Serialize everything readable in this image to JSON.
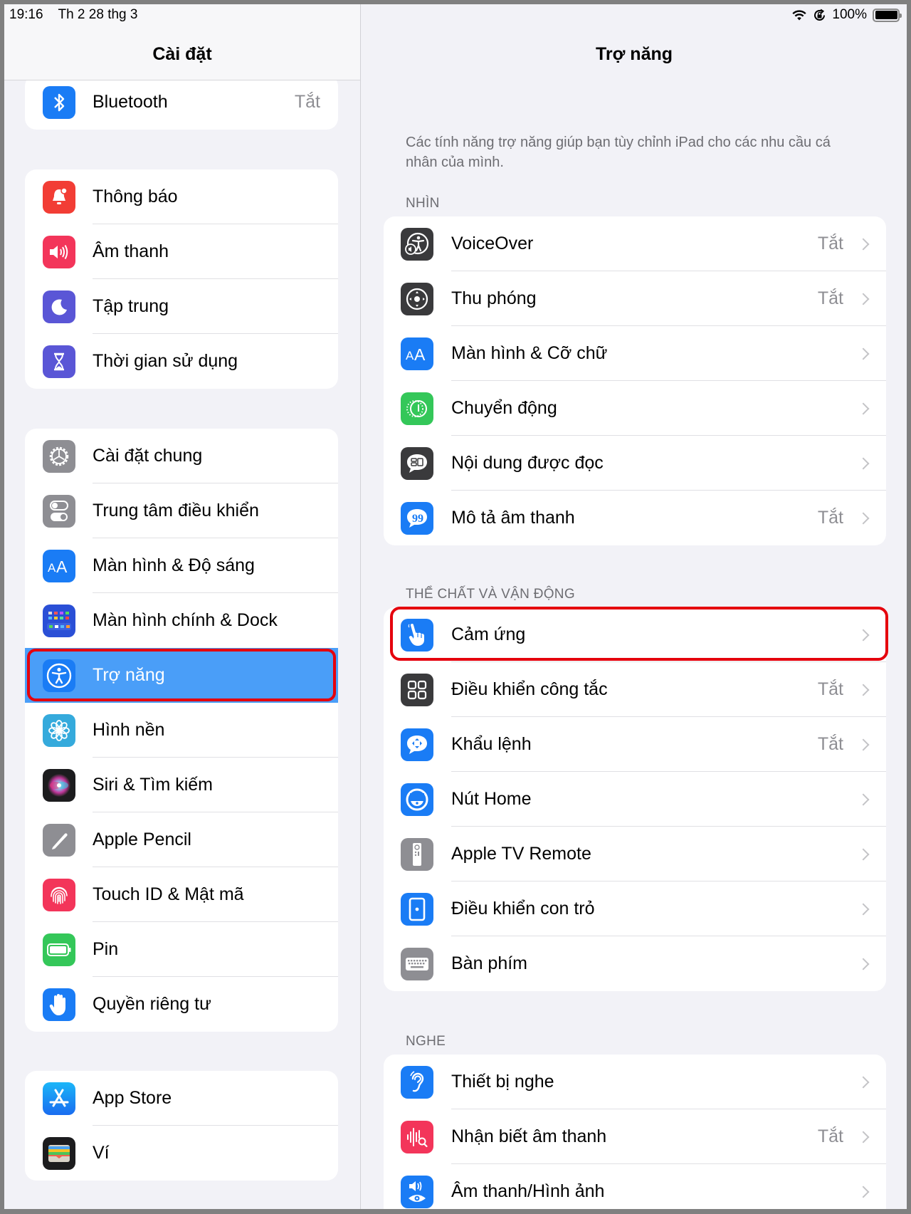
{
  "status_bar": {
    "time": "19:16",
    "date": "Th 2 28 thg 3",
    "battery_percent": "100%",
    "icons": [
      "wifi-icon",
      "orientation-lock-icon",
      "battery-icon"
    ]
  },
  "sidebar": {
    "title": "Cài đặt",
    "groups": [
      [
        {
          "label": "Bluetooth",
          "value": "Tắt",
          "icon": "bluetooth-icon",
          "color": "#1a7cf5"
        }
      ],
      [
        {
          "label": "Thông báo",
          "icon": "bell-icon",
          "color": "#f23d35"
        },
        {
          "label": "Âm thanh",
          "icon": "speaker-icon",
          "color": "#f3355a"
        },
        {
          "label": "Tập trung",
          "icon": "moon-icon",
          "color": "#5a56d6"
        },
        {
          "label": "Thời gian sử dụng",
          "icon": "hourglass-icon",
          "color": "#5a56d6"
        }
      ],
      [
        {
          "label": "Cài đặt chung",
          "icon": "gear-icon",
          "color": "#8e8e93"
        },
        {
          "label": "Trung tâm điều khiển",
          "icon": "toggles-icon",
          "color": "#8e8e93"
        },
        {
          "label": "Màn hình & Độ sáng",
          "icon": "text-size-icon",
          "color": "#1a7cf5"
        },
        {
          "label": "Màn hình chính & Dock",
          "icon": "home-grid-icon",
          "color": "#2a4fd6"
        },
        {
          "label": "Trợ năng",
          "icon": "accessibility-icon",
          "color": "#1a7cf5",
          "selected": true
        },
        {
          "label": "Hình nền",
          "icon": "flower-icon",
          "color": "#35aadc"
        },
        {
          "label": "Siri & Tìm kiếm",
          "icon": "siri-icon",
          "color": "#222222"
        },
        {
          "label": "Apple Pencil",
          "icon": "pencil-icon",
          "color": "#8e8e93"
        },
        {
          "label": "Touch ID & Mật mã",
          "icon": "fingerprint-icon",
          "color": "#f3355a"
        },
        {
          "label": "Pin",
          "icon": "battery-icon",
          "color": "#34c759"
        },
        {
          "label": "Quyền riêng tư",
          "icon": "hand-icon",
          "color": "#1a7cf5"
        }
      ],
      [
        {
          "label": "App Store",
          "icon": "app-store-icon",
          "color": "#1a8cf5"
        },
        {
          "label": "Ví",
          "icon": "wallet-icon",
          "color": "#1c1c1e"
        }
      ]
    ]
  },
  "detail": {
    "title": "Trợ năng",
    "description": "Các tính năng trợ năng giúp bạn tùy chỉnh iPad cho các nhu cầu cá nhân của mình.",
    "sections": [
      {
        "header": "NHÌN",
        "items": [
          {
            "label": "VoiceOver",
            "value": "Tắt",
            "icon": "voiceover-icon",
            "color": "#3a3a3c"
          },
          {
            "label": "Thu phóng",
            "value": "Tắt",
            "icon": "zoom-icon",
            "color": "#3a3a3c"
          },
          {
            "label": "Màn hình & Cỡ chữ",
            "value": "",
            "icon": "text-size-icon",
            "color": "#1a7cf5"
          },
          {
            "label": "Chuyển động",
            "value": "",
            "icon": "motion-icon",
            "color": "#34c759"
          },
          {
            "label": "Nội dung được đọc",
            "value": "",
            "icon": "spoken-content-icon",
            "color": "#3a3a3c"
          },
          {
            "label": "Mô tả âm thanh",
            "value": "Tắt",
            "icon": "audio-description-icon",
            "color": "#1a7cf5"
          }
        ]
      },
      {
        "header": "THỂ CHẤT VÀ VẬN ĐỘNG",
        "items": [
          {
            "label": "Cảm ứng",
            "value": "",
            "icon": "touch-hand-icon",
            "color": "#1a7cf5",
            "highlighted": true
          },
          {
            "label": "Điều khiển công tắc",
            "value": "Tắt",
            "icon": "switch-control-icon",
            "color": "#3a3a3c"
          },
          {
            "label": "Khẩu lệnh",
            "value": "Tắt",
            "icon": "voice-control-icon",
            "color": "#1a7cf5"
          },
          {
            "label": "Nút Home",
            "value": "",
            "icon": "home-button-icon",
            "color": "#1a7cf5"
          },
          {
            "label": "Apple TV Remote",
            "value": "",
            "icon": "remote-icon",
            "color": "#8e8e93"
          },
          {
            "label": "Điều khiển con trỏ",
            "value": "",
            "icon": "pointer-control-icon",
            "color": "#1a7cf5"
          },
          {
            "label": "Bàn phím",
            "value": "",
            "icon": "keyboard-icon",
            "color": "#8e8e93"
          }
        ]
      },
      {
        "header": "NGHE",
        "items": [
          {
            "label": "Thiết bị nghe",
            "value": "",
            "icon": "ear-icon",
            "color": "#1a7cf5"
          },
          {
            "label": "Nhận biết âm thanh",
            "value": "Tắt",
            "icon": "sound-recognition-icon",
            "color": "#f3355a"
          },
          {
            "label": "Âm thanh/Hình ảnh",
            "value": "",
            "icon": "audio-visual-icon",
            "color": "#1a7cf5"
          }
        ]
      }
    ]
  }
}
